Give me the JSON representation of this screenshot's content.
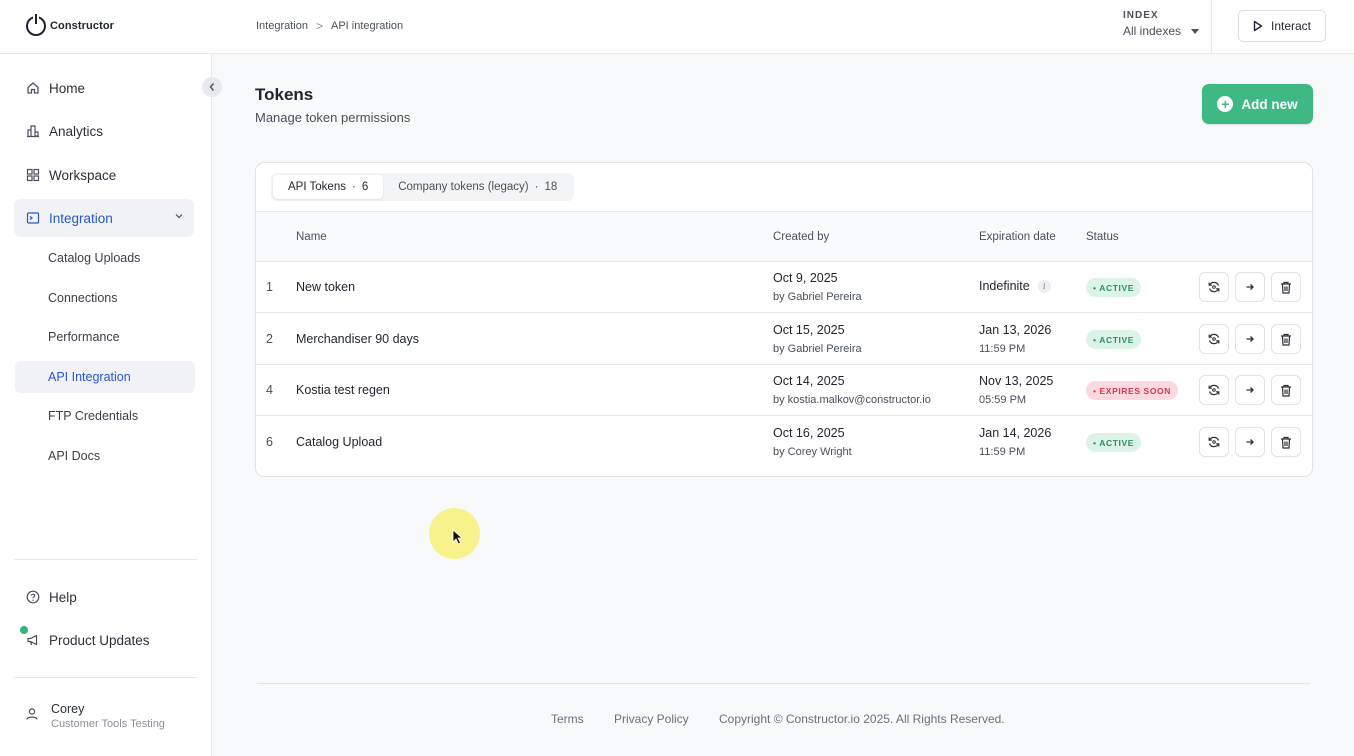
{
  "app": {
    "logo_text": "Constructor"
  },
  "breadcrumb": {
    "parent": "Integration",
    "separator": ">",
    "current": "API integration"
  },
  "index_selector": {
    "label": "INDEX",
    "value": "All indexes"
  },
  "topbar": {
    "interact_label": "Interact"
  },
  "sidebar": {
    "nav": [
      {
        "label": "Home",
        "icon": "home-icon"
      },
      {
        "label": "Analytics",
        "icon": "bar-chart-icon"
      },
      {
        "label": "Workspace",
        "icon": "grid-icon"
      },
      {
        "label": "Integration",
        "icon": "terminal-icon",
        "expanded": true
      }
    ],
    "sub_items": [
      {
        "label": "Catalog Uploads"
      },
      {
        "label": "Connections"
      },
      {
        "label": "Performance"
      },
      {
        "label": "API Integration",
        "active": true
      },
      {
        "label": "FTP Credentials"
      },
      {
        "label": "API Docs"
      }
    ],
    "bottom": [
      {
        "label": "Help",
        "icon": "help-circle-icon"
      },
      {
        "label": "Product Updates",
        "icon": "megaphone-icon"
      }
    ],
    "user": {
      "name": "Corey",
      "org": "Customer Tools Testing"
    }
  },
  "main": {
    "title": "Tokens",
    "subtitle": "Manage token permissions",
    "add_label": "Add new",
    "tabs": [
      {
        "label": "API Tokens",
        "count": "6",
        "active": true
      },
      {
        "label": "Company tokens (legacy)",
        "count": "18"
      }
    ],
    "tab_dot": "·",
    "columns": {
      "name": "Name",
      "created_by": "Created by",
      "expiration": "Expiration date",
      "status": "Status"
    },
    "rows": [
      {
        "num": "1",
        "name": "New token",
        "created_date": "Oct 9, 2025",
        "created_by": "by Gabriel Pereira",
        "exp_date": "Indefinite",
        "exp_time": "",
        "status": "• ACTIVE",
        "status_kind": "active"
      },
      {
        "num": "2",
        "name": "Merchandiser 90 days",
        "created_date": "Oct 15, 2025",
        "created_by": "by Gabriel Pereira",
        "exp_date": "Jan 13, 2026",
        "exp_time": "11:59 PM",
        "status": "• ACTIVE",
        "status_kind": "active"
      },
      {
        "num": "4",
        "name": "Kostia test regen",
        "created_date": "Oct 14, 2025",
        "created_by": "by kostia.malkov@constructor.io",
        "exp_date": "Nov 13, 2025",
        "exp_time": "05:59 PM",
        "status": "• EXPIRES SOON",
        "status_kind": "soon"
      },
      {
        "num": "6",
        "name": "Catalog Upload",
        "created_date": "Oct 16, 2025",
        "created_by": "by Corey Wright",
        "exp_date": "Jan 14, 2026",
        "exp_time": "11:59 PM",
        "status": "• ACTIVE",
        "status_kind": "active"
      }
    ]
  },
  "footer": {
    "terms": "Terms",
    "privacy": "Privacy Policy",
    "copyright": "Copyright © Constructor.io 2025. All Rights Reserved."
  },
  "colors": {
    "accent": "#2b58c9",
    "primary_button": "#3fb984",
    "active_badge_bg": "#dcf3e8",
    "soon_badge_bg": "#fbd9de"
  }
}
